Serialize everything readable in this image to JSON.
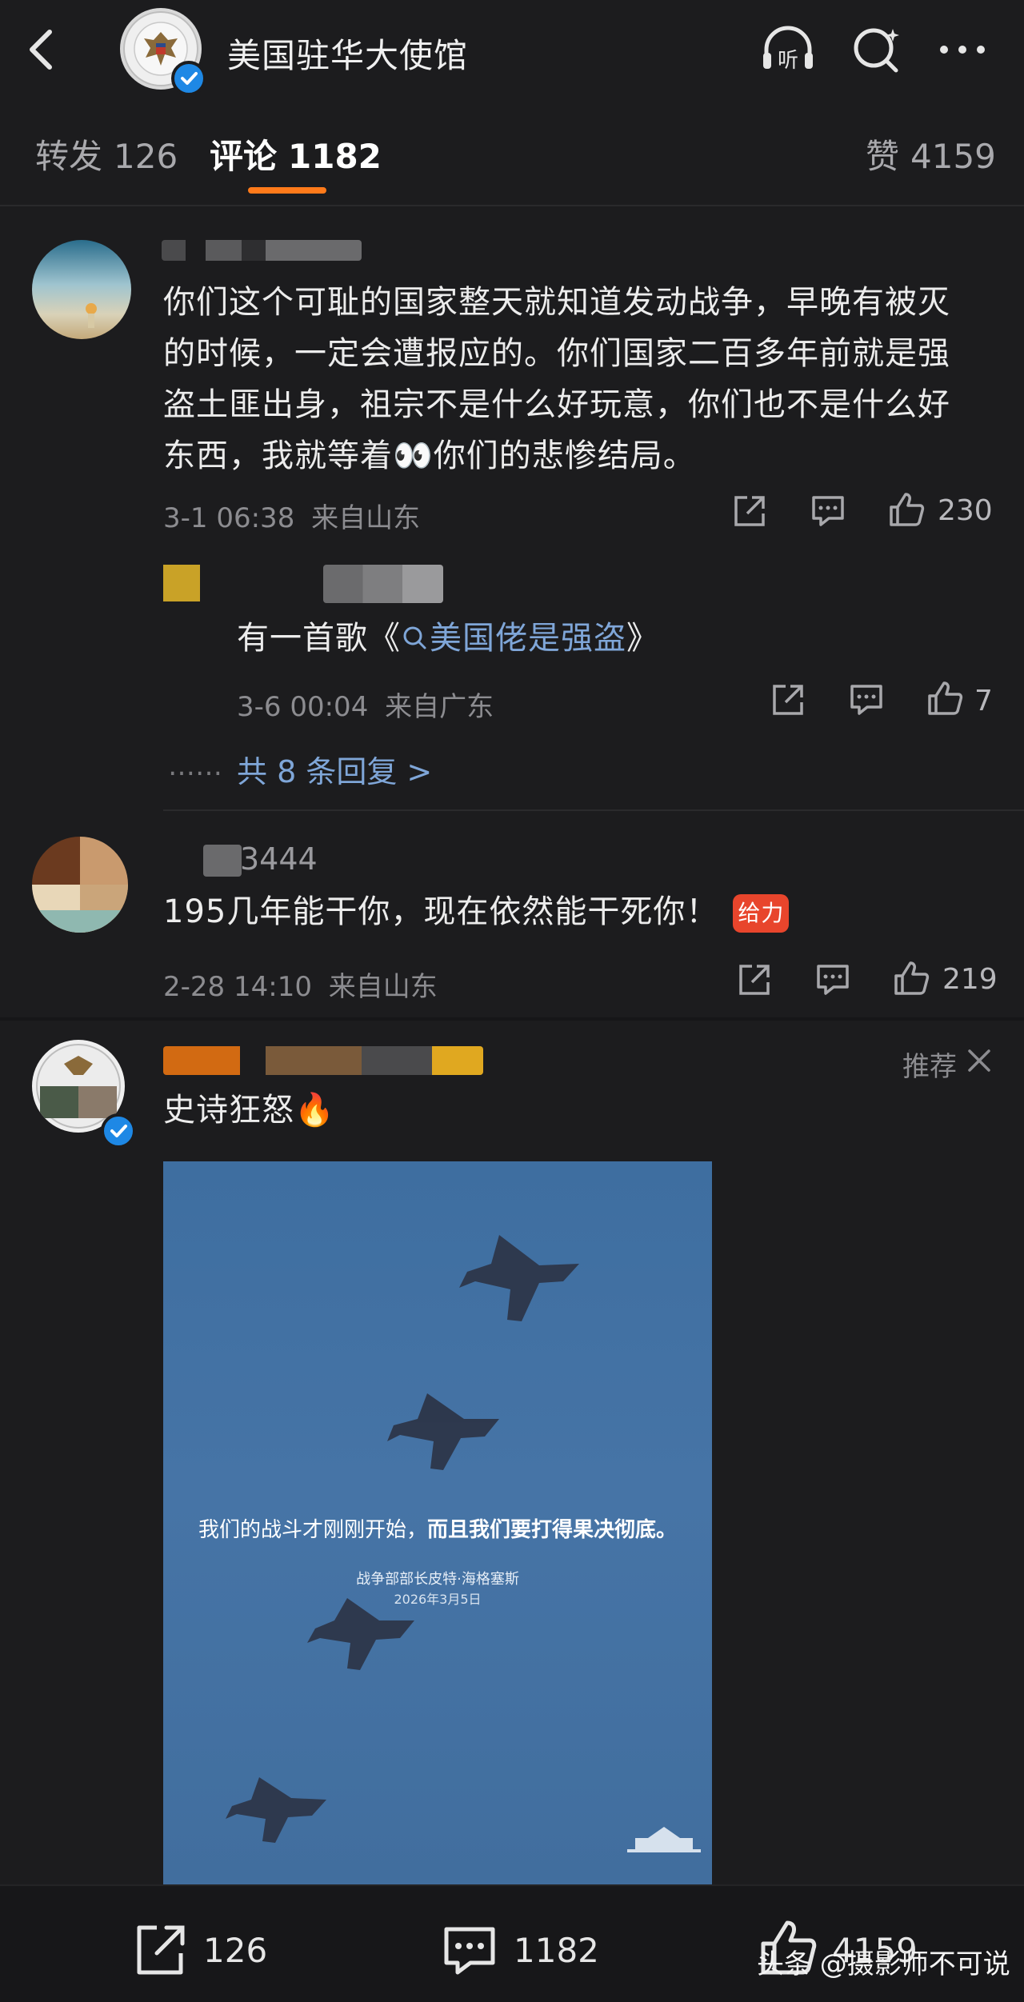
{
  "header": {
    "account_name": "美国驻华大使馆",
    "icons": [
      "back-icon",
      "listen-icon",
      "search-icon",
      "more-icon"
    ],
    "listen_label": "听"
  },
  "tabs": [
    {
      "label": "转发",
      "count": "126",
      "active": false
    },
    {
      "label": "评论",
      "count": "1182",
      "active": true
    },
    {
      "label": "赞",
      "count": "4159",
      "active": false
    }
  ],
  "comments": [
    {
      "text": "你们这个可耻的国家整天就知道发动战争，早晚有被灭的时候，一定会遭报应的。你们国家二百多年前就是强盗土匪出身，祖宗不是什么好玩意，你们也不是什么好东西，我就等着👀你们的悲惨结局。",
      "time": "3-1 06:38",
      "location": "来自山东",
      "likes": "230",
      "reply": {
        "prefix": "有一首歌《",
        "link": "美国佬是强盗",
        "suffix": "》",
        "time": "3-6 00:04",
        "location": "来自广东",
        "likes": "7"
      },
      "more_replies": "共 8 条回复 >",
      "dots": "……"
    },
    {
      "name_fragment": "3444",
      "text": "195几年能干你，现在依然能干死你！",
      "badge": "给力",
      "time": "2-28 14:10",
      "location": "来自山东",
      "likes": "219"
    },
    {
      "text": "史诗狂怒🔥",
      "recommend": "推荐",
      "image": {
        "caption_normal": "我们的战斗才刚刚开始，",
        "caption_bold": "而且我们要打得果决彻底。",
        "sub": "战争部部长皮特·海格塞斯",
        "date": "2026年3月5日"
      }
    }
  ],
  "bottom_bar": {
    "share_count": "126",
    "comment_count": "1182",
    "like_count": "4159"
  },
  "watermark": "头条 @摄影师不可说",
  "colors": {
    "accent": "#ff7a1a",
    "link": "#7fa6d8",
    "verified": "#1e88e5",
    "background": "#1c1c1e"
  }
}
